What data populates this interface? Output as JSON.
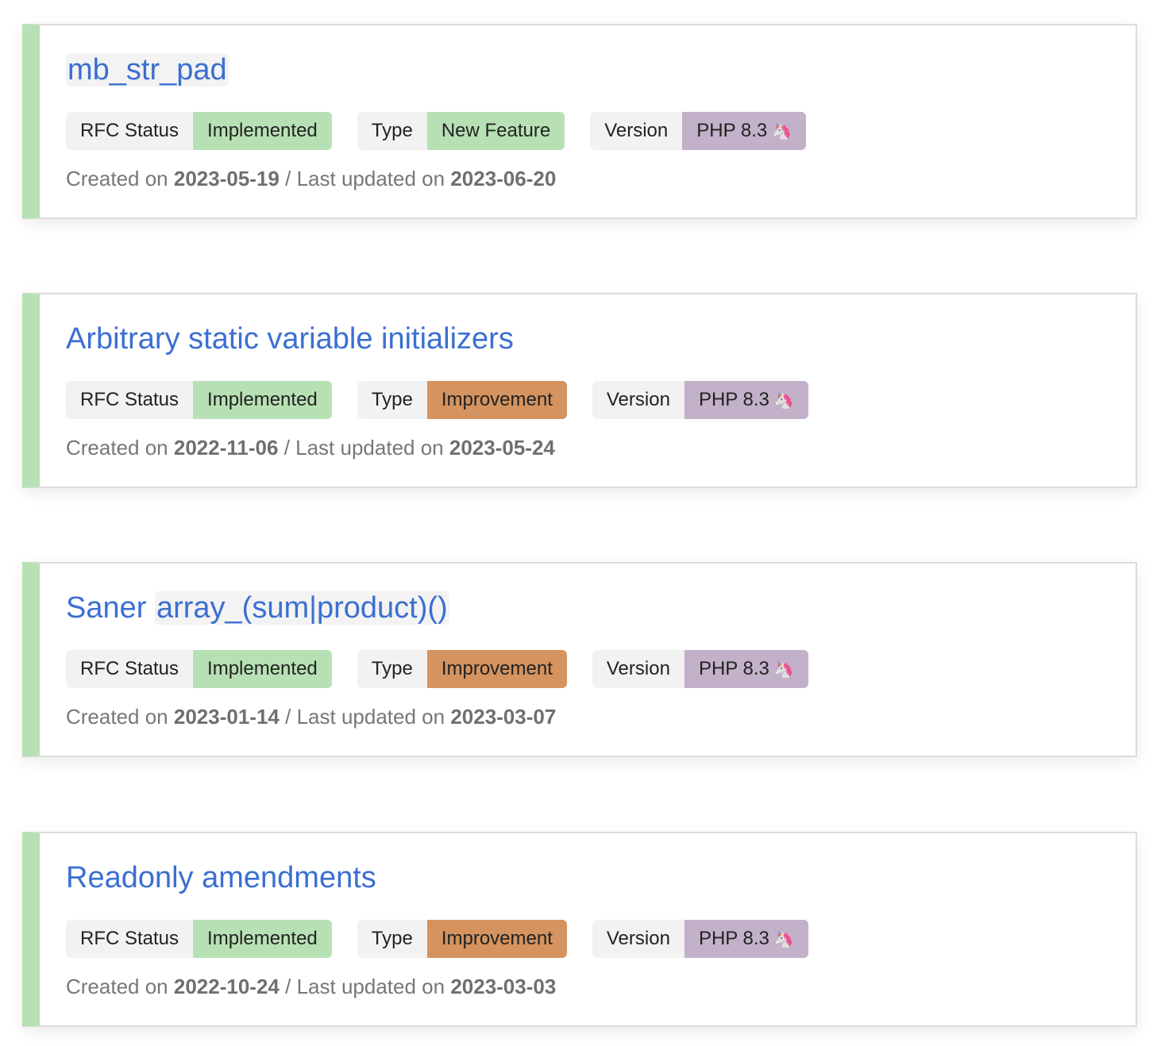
{
  "labels": {
    "rfc_status": "RFC Status",
    "type": "Type",
    "version": "Version",
    "created_on": "Created on",
    "last_updated_on": "/ Last updated on"
  },
  "colors": {
    "implemented": "#b7e1b4",
    "new_feature": "#b7e1b4",
    "improvement": "#d4935f",
    "version": "#c2b1c9",
    "title_link": "#3b6fd1",
    "card_accent": "#b7e1b4"
  },
  "rfcs": [
    {
      "title_prefix": "",
      "title_code": "mb_str_pad",
      "status": "Implemented",
      "type": "New Feature",
      "version": "PHP 8.3",
      "version_icon": "unicorn-icon",
      "created": "2023-05-19",
      "updated": "2023-06-20"
    },
    {
      "title_prefix": "Arbitrary static variable initializers",
      "title_code": "",
      "status": "Implemented",
      "type": "Improvement",
      "version": "PHP 8.3",
      "version_icon": "unicorn-icon",
      "created": "2022-11-06",
      "updated": "2023-05-24"
    },
    {
      "title_prefix": "Saner ",
      "title_code": "array_(sum|product)()",
      "status": "Implemented",
      "type": "Improvement",
      "version": "PHP 8.3",
      "version_icon": "unicorn-icon",
      "created": "2023-01-14",
      "updated": "2023-03-07"
    },
    {
      "title_prefix": "Readonly amendments",
      "title_code": "",
      "status": "Implemented",
      "type": "Improvement",
      "version": "PHP 8.3",
      "version_icon": "unicorn-icon",
      "created": "2022-10-24",
      "updated": "2023-03-03"
    }
  ]
}
